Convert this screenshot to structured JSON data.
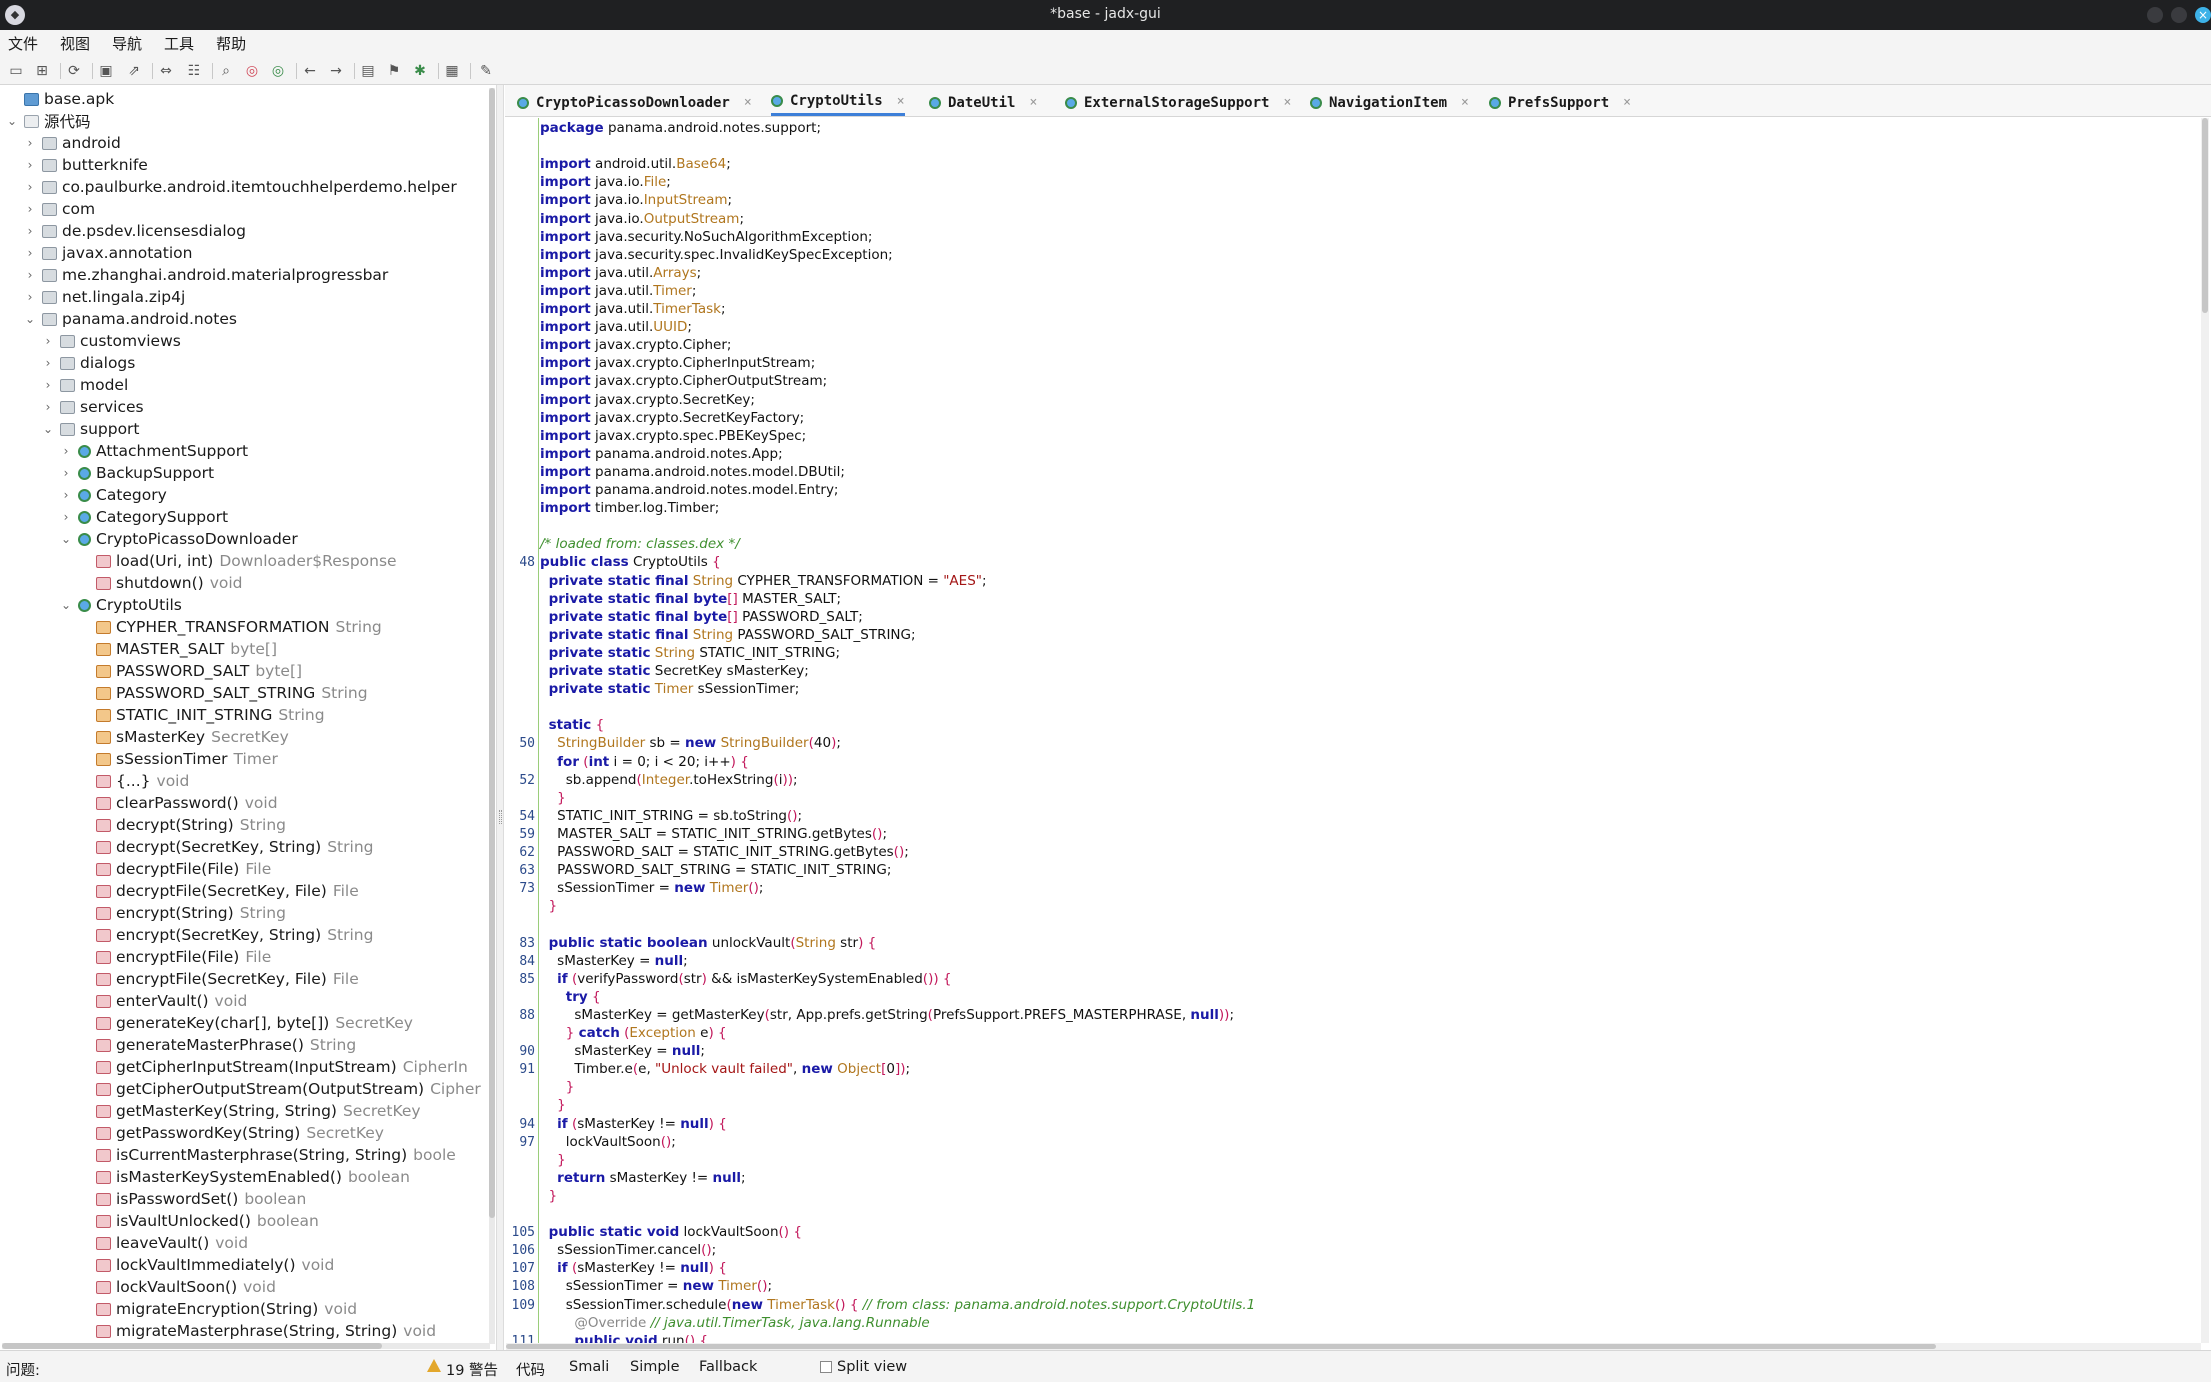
{
  "window": {
    "title": "*base - jadx-gui"
  },
  "menu": [
    "文件",
    "视图",
    "导航",
    "工具",
    "帮助"
  ],
  "toolbar_icons": [
    "open-file-icon",
    "add-files-icon",
    "reload-icon",
    "save-all-icon",
    "export-icon",
    "sync-icon",
    "flatten-icon",
    "search-icon",
    "find-class-icon",
    "find-usage-icon",
    "back-icon",
    "forward-icon",
    "decompile-icon",
    "bookmark-icon",
    "debug-icon",
    "log-icon",
    "preferences-icon"
  ],
  "tree": {
    "root": "base.apk",
    "source_root": "源代码",
    "packages": [
      "android",
      "butterknife",
      "co.paulburke.android.itemtouchhelperdemo.helper",
      "com",
      "de.psdev.licensesdialog",
      "javax.annotation",
      "me.zhanghai.android.materialprogressbar",
      "net.lingala.zip4j"
    ],
    "expanded_package": "panama.android.notes",
    "subpackages": [
      "customviews",
      "dialogs",
      "model",
      "services"
    ],
    "support_package": "support",
    "support_classes": [
      "AttachmentSupport",
      "BackupSupport",
      "Category",
      "CategorySupport"
    ],
    "downloader_class": "CryptoPicassoDownloader",
    "downloader_members": [
      {
        "name": "load(Uri, int)",
        "type": "Downloader$Response"
      },
      {
        "name": "shutdown()",
        "type": "void"
      }
    ],
    "crypto_class": "CryptoUtils",
    "crypto_fields": [
      {
        "name": "CYPHER_TRANSFORMATION",
        "type": "String"
      },
      {
        "name": "MASTER_SALT",
        "type": "byte[]"
      },
      {
        "name": "PASSWORD_SALT",
        "type": "byte[]"
      },
      {
        "name": "PASSWORD_SALT_STRING",
        "type": "String"
      },
      {
        "name": "STATIC_INIT_STRING",
        "type": "String"
      },
      {
        "name": "sMasterKey",
        "type": "SecretKey"
      },
      {
        "name": "sSessionTimer",
        "type": "Timer"
      }
    ],
    "crypto_methods": [
      {
        "name": "{...}",
        "type": "void"
      },
      {
        "name": "clearPassword()",
        "type": "void"
      },
      {
        "name": "decrypt(String)",
        "type": "String"
      },
      {
        "name": "decrypt(SecretKey, String)",
        "type": "String"
      },
      {
        "name": "decryptFile(File)",
        "type": "File"
      },
      {
        "name": "decryptFile(SecretKey, File)",
        "type": "File"
      },
      {
        "name": "encrypt(String)",
        "type": "String"
      },
      {
        "name": "encrypt(SecretKey, String)",
        "type": "String"
      },
      {
        "name": "encryptFile(File)",
        "type": "File"
      },
      {
        "name": "encryptFile(SecretKey, File)",
        "type": "File"
      },
      {
        "name": "enterVault()",
        "type": "void"
      },
      {
        "name": "generateKey(char[], byte[])",
        "type": "SecretKey"
      },
      {
        "name": "generateMasterPhrase()",
        "type": "String"
      },
      {
        "name": "getCipherInputStream(InputStream)",
        "type": "CipherIn"
      },
      {
        "name": "getCipherOutputStream(OutputStream)",
        "type": "Cipher"
      },
      {
        "name": "getMasterKey(String, String)",
        "type": "SecretKey"
      },
      {
        "name": "getPasswordKey(String)",
        "type": "SecretKey"
      },
      {
        "name": "isCurrentMasterphrase(String, String)",
        "type": "boole"
      },
      {
        "name": "isMasterKeySystemEnabled()",
        "type": "boolean"
      },
      {
        "name": "isPasswordSet()",
        "type": "boolean"
      },
      {
        "name": "isVaultUnlocked()",
        "type": "boolean"
      },
      {
        "name": "leaveVault()",
        "type": "void"
      },
      {
        "name": "lockVaultImmediately()",
        "type": "void"
      },
      {
        "name": "lockVaultSoon()",
        "type": "void"
      },
      {
        "name": "migrateEncryption(String)",
        "type": "void"
      },
      {
        "name": "migrateMasterphrase(String, String)",
        "type": "void"
      }
    ]
  },
  "tabs": [
    {
      "label": "CryptoPicassoDownloader",
      "active": false
    },
    {
      "label": "CryptoUtils",
      "active": true
    },
    {
      "label": "DateUtil",
      "active": false
    },
    {
      "label": "ExternalStorageSupport",
      "active": false
    },
    {
      "label": "NavigationItem",
      "active": false
    },
    {
      "label": "PrefsSupport",
      "active": false
    }
  ],
  "code": [
    {
      "ln": "",
      "html": "<span class='kw'>package</span> panama.android.notes.support;"
    },
    {
      "ln": "",
      "html": ""
    },
    {
      "ln": "",
      "html": "<span class='kw'>import</span> android.util.<span class='ty'>Base64</span>;"
    },
    {
      "ln": "",
      "html": "<span class='kw'>import</span> java.io.<span class='ty'>File</span>;"
    },
    {
      "ln": "",
      "html": "<span class='kw'>import</span> java.io.<span class='ty'>InputStream</span>;"
    },
    {
      "ln": "",
      "html": "<span class='kw'>import</span> java.io.<span class='ty'>OutputStream</span>;"
    },
    {
      "ln": "",
      "html": "<span class='kw'>import</span> java.security.NoSuchAlgorithmException;"
    },
    {
      "ln": "",
      "html": "<span class='kw'>import</span> java.security.spec.InvalidKeySpecException;"
    },
    {
      "ln": "",
      "html": "<span class='kw'>import</span> java.util.<span class='ty'>Arrays</span>;"
    },
    {
      "ln": "",
      "html": "<span class='kw'>import</span> java.util.<span class='ty'>Timer</span>;"
    },
    {
      "ln": "",
      "html": "<span class='kw'>import</span> java.util.<span class='ty'>TimerTask</span>;"
    },
    {
      "ln": "",
      "html": "<span class='kw'>import</span> java.util.<span class='ty'>UUID</span>;"
    },
    {
      "ln": "",
      "html": "<span class='kw'>import</span> javax.crypto.Cipher;"
    },
    {
      "ln": "",
      "html": "<span class='kw'>import</span> javax.crypto.CipherInputStream;"
    },
    {
      "ln": "",
      "html": "<span class='kw'>import</span> javax.crypto.CipherOutputStream;"
    },
    {
      "ln": "",
      "html": "<span class='kw'>import</span> javax.crypto.SecretKey;"
    },
    {
      "ln": "",
      "html": "<span class='kw'>import</span> javax.crypto.SecretKeyFactory;"
    },
    {
      "ln": "",
      "html": "<span class='kw'>import</span> javax.crypto.spec.PBEKeySpec;"
    },
    {
      "ln": "",
      "html": "<span class='kw'>import</span> panama.android.notes.App;"
    },
    {
      "ln": "",
      "html": "<span class='kw'>import</span> panama.android.notes.model.DBUtil;"
    },
    {
      "ln": "",
      "html": "<span class='kw'>import</span> panama.android.notes.model.Entry;"
    },
    {
      "ln": "",
      "html": "<span class='kw'>import</span> timber.log.Timber;"
    },
    {
      "ln": "",
      "html": ""
    },
    {
      "ln": "",
      "html": "<span class='cm'>/* loaded from: classes.dex */</span>"
    },
    {
      "ln": "48",
      "html": "<span class='kw'>public class</span> CryptoUtils <span class='nm'>{</span>"
    },
    {
      "ln": "",
      "html": "  <span class='kw'>private static final</span> <span class='ty'>String</span> CYPHER_TRANSFORMATION = <span class='st'>\"AES\"</span>;"
    },
    {
      "ln": "",
      "html": "  <span class='kw'>private static final byte</span><span class='nm'>[]</span> MASTER_SALT;"
    },
    {
      "ln": "",
      "html": "  <span class='kw'>private static final byte</span><span class='nm'>[]</span> PASSWORD_SALT;"
    },
    {
      "ln": "",
      "html": "  <span class='kw'>private static final</span> <span class='ty'>String</span> PASSWORD_SALT_STRING;"
    },
    {
      "ln": "",
      "html": "  <span class='kw'>private static</span> <span class='ty'>String</span> STATIC_INIT_STRING;"
    },
    {
      "ln": "",
      "html": "  <span class='kw'>private static</span> SecretKey sMasterKey;"
    },
    {
      "ln": "",
      "html": "  <span class='kw'>private static</span> <span class='ty'>Timer</span> sSessionTimer;"
    },
    {
      "ln": "",
      "html": ""
    },
    {
      "ln": "",
      "html": "  <span class='kw'>static</span> <span class='nm'>{</span>"
    },
    {
      "ln": "50",
      "html": "    <span class='ty'>StringBuilder</span> sb = <span class='kw'>new</span> <span class='ty'>StringBuilder</span><span class='nm'>(</span>40<span class='nm'>)</span>;"
    },
    {
      "ln": "",
      "html": "    <span class='kw'>for</span> <span class='nm'>(</span><span class='kw'>int</span> i = 0; i &lt; 20; i++<span class='nm'>)</span> <span class='nm'>{</span>"
    },
    {
      "ln": "52",
      "html": "      sb.append<span class='nm'>(</span><span class='ty'>Integer</span>.toHexString<span class='nm'>(</span>i<span class='nm'>))</span>;"
    },
    {
      "ln": "",
      "html": "    <span class='nm'>}</span>"
    },
    {
      "ln": "54",
      "html": "    STATIC_INIT_STRING = sb.toString<span class='nm'>()</span>;"
    },
    {
      "ln": "59",
      "html": "    MASTER_SALT = STATIC_INIT_STRING.getBytes<span class='nm'>()</span>;"
    },
    {
      "ln": "62",
      "html": "    PASSWORD_SALT = STATIC_INIT_STRING.getBytes<span class='nm'>()</span>;"
    },
    {
      "ln": "63",
      "html": "    PASSWORD_SALT_STRING = STATIC_INIT_STRING;"
    },
    {
      "ln": "73",
      "html": "    sSessionTimer = <span class='kw'>new</span> <span class='ty'>Timer</span><span class='nm'>()</span>;"
    },
    {
      "ln": "",
      "html": "  <span class='nm'>}</span>"
    },
    {
      "ln": "",
      "html": ""
    },
    {
      "ln": "83",
      "html": "  <span class='kw'>public static boolean</span> unlockVault<span class='nm'>(</span><span class='ty'>String</span> str<span class='nm'>)</span> <span class='nm'>{</span>"
    },
    {
      "ln": "84",
      "html": "    sMasterKey = <span class='kw'>null</span>;"
    },
    {
      "ln": "85",
      "html": "    <span class='kw'>if</span> <span class='nm'>(</span>verifyPassword<span class='nm'>(</span>str<span class='nm'>)</span> &amp;&amp; isMasterKeySystemEnabled<span class='nm'>())</span> <span class='nm'>{</span>"
    },
    {
      "ln": "",
      "html": "      <span class='kw'>try</span> <span class='nm'>{</span>"
    },
    {
      "ln": "88",
      "html": "        sMasterKey = getMasterKey<span class='nm'>(</span>str, App.prefs.getString<span class='nm'>(</span>PrefsSupport.PREFS_MASTERPHRASE, <span class='kw'>null</span><span class='nm'>))</span>;"
    },
    {
      "ln": "",
      "html": "      <span class='nm'>}</span> <span class='kw'>catch</span> <span class='nm'>(</span><span class='ty'>Exception</span> e<span class='nm'>)</span> <span class='nm'>{</span>"
    },
    {
      "ln": "90",
      "html": "        sMasterKey = <span class='kw'>null</span>;"
    },
    {
      "ln": "91",
      "html": "        Timber.e<span class='nm'>(</span>e, <span class='st'>\"Unlock vault failed\"</span>, <span class='kw'>new</span> <span class='ty'>Object</span><span class='nm'>[</span>0<span class='nm'>])</span>;"
    },
    {
      "ln": "",
      "html": "      <span class='nm'>}</span>"
    },
    {
      "ln": "",
      "html": "    <span class='nm'>}</span>"
    },
    {
      "ln": "94",
      "html": "    <span class='kw'>if</span> <span class='nm'>(</span>sMasterKey != <span class='kw'>null</span><span class='nm'>)</span> <span class='nm'>{</span>"
    },
    {
      "ln": "97",
      "html": "      lockVaultSoon<span class='nm'>()</span>;"
    },
    {
      "ln": "",
      "html": "    <span class='nm'>}</span>"
    },
    {
      "ln": "",
      "html": "    <span class='kw'>return</span> sMasterKey != <span class='kw'>null</span>;"
    },
    {
      "ln": "",
      "html": "  <span class='nm'>}</span>"
    },
    {
      "ln": "",
      "html": ""
    },
    {
      "ln": "105",
      "html": "  <span class='kw'>public static void</span> lockVaultSoon<span class='nm'>()</span> <span class='nm'>{</span>"
    },
    {
      "ln": "106",
      "html": "    sSessionTimer.cancel<span class='nm'>()</span>;"
    },
    {
      "ln": "107",
      "html": "    <span class='kw'>if</span> <span class='nm'>(</span>sMasterKey != <span class='kw'>null</span><span class='nm'>)</span> <span class='nm'>{</span>"
    },
    {
      "ln": "108",
      "html": "      sSessionTimer = <span class='kw'>new</span> <span class='ty'>Timer</span><span class='nm'>()</span>;"
    },
    {
      "ln": "109",
      "html": "      sSessionTimer.schedule<span class='nm'>(</span><span class='kw'>new</span> <span class='ty'>TimerTask</span><span class='nm'>()</span> <span class='nm'>{</span> <span class='cm'>// from class: panama.android.notes.support.CryptoUtils.1</span>"
    },
    {
      "ln": "",
      "html": "        <span class='an'>@Override</span> <span class='cm'>// java.util.TimerTask, java.lang.Runnable</span>"
    },
    {
      "ln": "111",
      "html": "        <span class='kw'>public void</span> run<span class='nm'>()</span> <span class='nm'>{</span>"
    }
  ],
  "status": {
    "problems_label": "问题:",
    "warnings": "19 警告",
    "bottom_tabs": [
      {
        "label": "代码",
        "active": true
      },
      {
        "label": "Smali",
        "active": false
      },
      {
        "label": "Simple",
        "active": false
      },
      {
        "label": "Fallback",
        "active": false
      }
    ],
    "split_view": "Split view"
  }
}
